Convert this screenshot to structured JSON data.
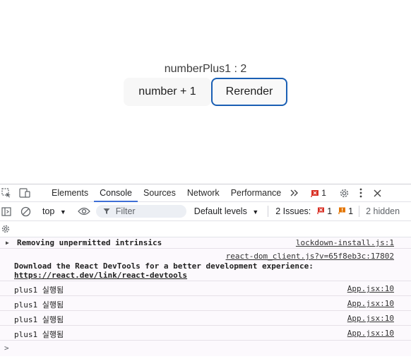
{
  "app": {
    "counter_label": "numberPlus1 : 2",
    "plus_button": "number + 1",
    "rerender_button": "Rerender"
  },
  "devtools": {
    "tabs": [
      "Elements",
      "Console",
      "Sources",
      "Network",
      "Performance"
    ],
    "active_tab": "Console",
    "more_tabs_glyph": ">>",
    "error_badge_count": "1",
    "toolbar": {
      "context": "top",
      "filter_placeholder": "Filter",
      "levels": "Default levels",
      "issues_label": "2 Issues:",
      "issues_error_count": "1",
      "issues_warning_count": "1",
      "hidden_label": "2 hidden"
    },
    "console": {
      "messages": [
        {
          "text": "Removing unpermitted intrinsics",
          "source": "lockdown-install.js:1"
        },
        {
          "source": "react-dom_client.js?v=65f8eb3c:17802",
          "line1": "Download the React DevTools for a better development experience:",
          "link": "https://react.dev/link/react-devtools"
        },
        {
          "text": "plus1 실행됨",
          "source": "App.jsx:10"
        },
        {
          "text": "plus1 실행됨",
          "source": "App.jsx:10"
        },
        {
          "text": "plus1 실행됨",
          "source": "App.jsx:10"
        },
        {
          "text": "plus1 실행됨",
          "source": "App.jsx:10"
        }
      ],
      "prompt_glyph": ">"
    }
  },
  "colors": {
    "accent": "#1a5fb4",
    "tab_underline": "#3f6fd6",
    "error": "#d93025",
    "warning": "#e37400",
    "console_bg": "#fcf9fd"
  }
}
